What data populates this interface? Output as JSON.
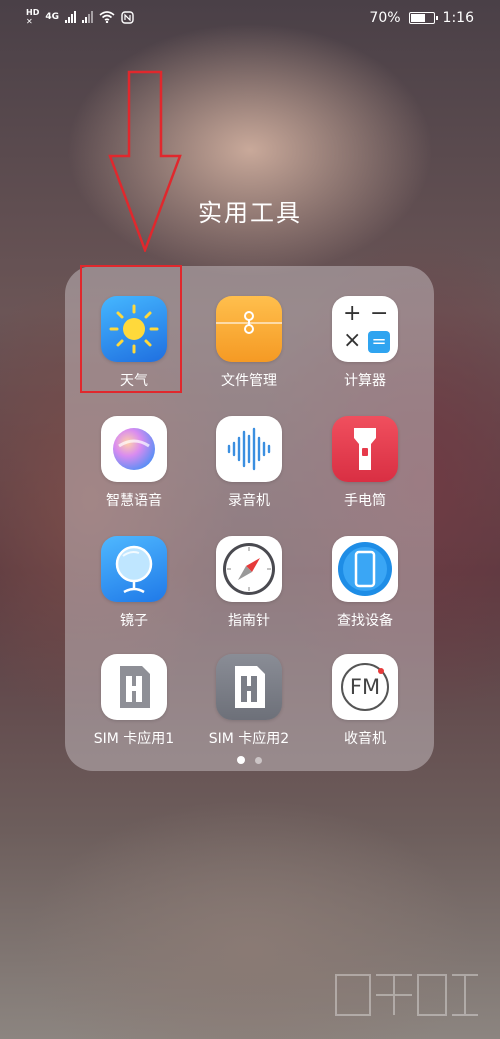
{
  "status_bar": {
    "hd_label": "HD",
    "network_label": "4G",
    "battery_percent_text": "70%",
    "battery_level": 0.7,
    "time": "1:16"
  },
  "folder": {
    "title": "实用工具",
    "apps": [
      {
        "label": "天气",
        "icon": "sun-icon"
      },
      {
        "label": "文件管理",
        "icon": "folder-icon"
      },
      {
        "label": "计算器",
        "icon": "calculator-icon"
      },
      {
        "label": "智慧语音",
        "icon": "voice-assistant-icon"
      },
      {
        "label": "录音机",
        "icon": "waveform-icon"
      },
      {
        "label": "手电筒",
        "icon": "flashlight-icon"
      },
      {
        "label": "镜子",
        "icon": "mirror-icon"
      },
      {
        "label": "指南针",
        "icon": "compass-icon"
      },
      {
        "label": "查找设备",
        "icon": "phone-icon"
      },
      {
        "label": "SIM 卡应用1",
        "icon": "sim-card-icon"
      },
      {
        "label": "SIM 卡应用2",
        "icon": "sim-card-icon"
      },
      {
        "label": "收音机",
        "icon": "fm-radio-icon"
      }
    ],
    "page_count": 2,
    "active_page": 1
  },
  "calculator_symbols": {
    "plus": "+",
    "minus": "−",
    "times": "×",
    "equals": "="
  },
  "radio_text": "FM",
  "colors": {
    "annotation_red": "#e0282d",
    "weather_blue": "#2f8ef0",
    "files_orange": "#f8a93a",
    "flashlight_red": "#e63a4b"
  }
}
